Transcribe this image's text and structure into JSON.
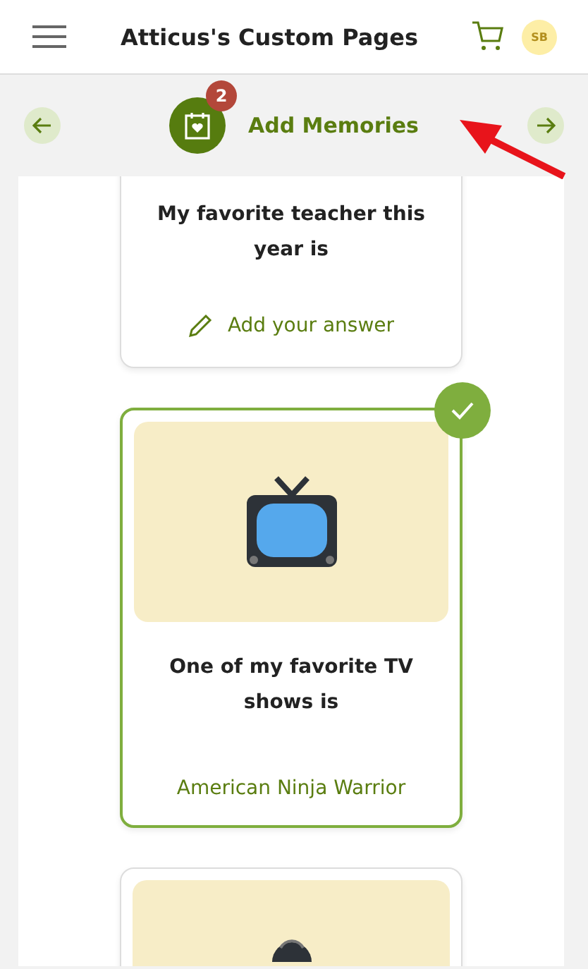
{
  "header": {
    "title": "Atticus's Custom Pages",
    "avatar": "SB"
  },
  "step": {
    "title": "Add Memories",
    "badge": "2"
  },
  "cards": [
    {
      "kind": "text",
      "prompt": "My favorite teacher this year is",
      "answered": false,
      "action": "Add your answer"
    },
    {
      "kind": "tv",
      "prompt": "One of my favorite TV shows is",
      "answered": true,
      "answer": "American Ninja Warrior"
    },
    {
      "kind": "ball",
      "answered": false
    }
  ]
}
